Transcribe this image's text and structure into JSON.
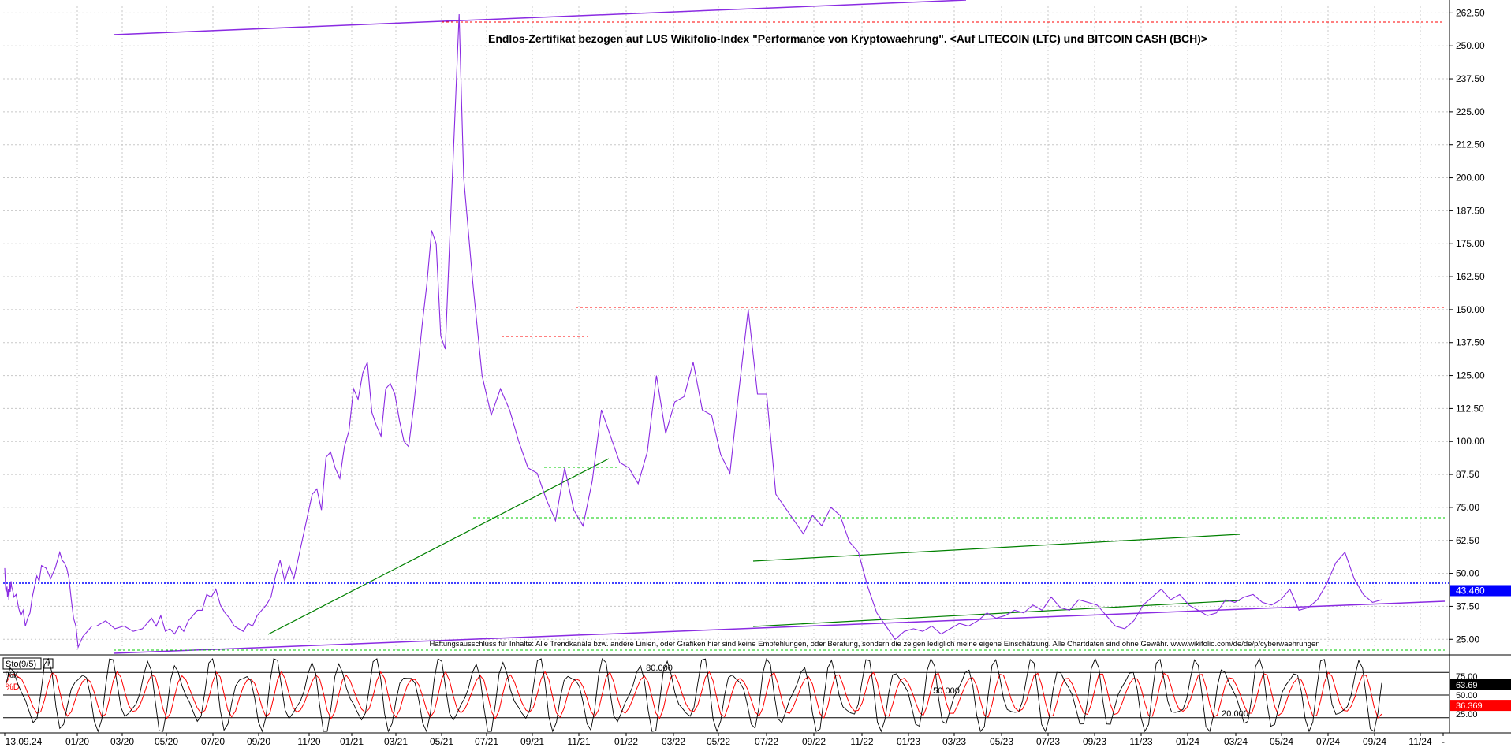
{
  "chart_data": {
    "type": "line",
    "title": "Endlos-Zertifikat bezogen auf LUS Wikifolio-Index \"Performance von Kryptowaehrung\". <Auf LITECOIN (LTC) und BITCOIN CASH (BCH)>",
    "disclaimer": "Haftungsausschluss für Inhalte: Alle Trendkanäle bzw. andere Linien, oder Grafiken hier sind keine Empfehlungen, oder Beratung, sondern die zeigen lediglich meine eigene Einschätzung. Alle Chartdaten sind ohne Gewähr.  www.wikifolio.com/de/de/p/cyberwaehrungen",
    "ylim": [
      20,
      265
    ],
    "y_ticks": [
      "262.50",
      "250.00",
      "237.50",
      "225.00",
      "212.50",
      "200.00",
      "187.50",
      "175.00",
      "162.50",
      "150.00",
      "137.50",
      "125.00",
      "112.50",
      "100.00",
      "87.50",
      "75.00",
      "62.50",
      "50.00",
      "37.50",
      "25.00"
    ],
    "x_ticks": [
      "13.09.24",
      "01/20",
      "03/20",
      "05/20",
      "07/20",
      "09/20",
      "11/20",
      "01/21",
      "03/21",
      "05/21",
      "07/21",
      "09/21",
      "11/21",
      "01/22",
      "03/22",
      "05/22",
      "07/22",
      "09/22",
      "11/22",
      "01/23",
      "03/23",
      "05/23",
      "07/23",
      "09/23",
      "11/23",
      "01/24",
      "03/24",
      "05/24",
      "07/24",
      "09/24",
      "11/24",
      "-"
    ],
    "last_value_label": "43.460",
    "price_series": {
      "name": "",
      "color": "#8a2be2",
      "x": [
        0,
        0.02,
        0.03,
        0.05,
        0.06,
        0.08,
        0.09,
        0.11,
        0.12,
        0.14,
        0.15,
        0.18,
        0.2,
        0.25,
        0.3,
        0.35,
        0.4,
        0.45,
        0.5,
        0.55,
        0.6,
        0.65,
        0.7,
        0.75,
        0.8,
        0.9,
        1.0,
        1.1,
        1.2,
        1.25,
        1.3,
        1.35,
        1.4,
        1.45,
        1.5,
        1.55,
        1.6,
        1.7,
        1.8,
        1.9,
        2.0,
        2.2,
        2.4,
        2.6,
        2.8,
        3.0,
        3.1,
        3.2,
        3.3,
        3.4,
        3.5,
        3.6,
        3.7,
        3.8,
        3.9,
        4.0,
        4.1,
        4.2,
        4.3,
        4.4,
        4.5,
        4.6,
        4.7,
        4.8,
        4.9,
        5.0,
        5.1,
        5.2,
        5.3,
        5.4,
        5.5,
        5.6,
        5.7,
        5.8,
        5.9,
        6.0,
        6.1,
        6.2,
        6.3,
        6.4,
        6.5,
        6.6,
        6.7,
        6.8,
        6.9,
        7.0,
        7.1,
        7.2,
        7.3,
        7.4,
        7.5,
        7.6,
        7.7,
        7.8,
        7.9,
        8.0,
        8.1,
        8.2,
        8.3,
        8.4,
        8.5,
        8.6,
        8.7,
        8.8,
        8.9,
        9.0,
        9.1,
        9.2,
        9.3,
        9.4,
        9.5,
        9.6,
        9.7,
        9.8,
        9.9,
        10.0,
        10.2,
        10.4,
        10.6,
        10.8,
        11.0,
        11.2,
        11.4,
        11.6,
        11.8,
        12.0,
        12.2,
        12.4,
        12.6,
        12.8,
        13.0,
        13.2,
        13.4,
        13.6,
        13.8,
        14.0,
        14.2,
        14.4,
        14.6,
        14.8,
        15.0,
        15.2,
        15.4,
        15.6,
        15.8,
        16.0,
        16.2,
        16.4,
        16.6,
        16.8,
        17.0,
        17.2,
        17.4,
        17.6,
        17.8,
        18.0,
        18.2,
        18.4,
        18.6,
        18.8,
        19.0,
        19.2,
        19.4,
        19.6,
        19.8,
        20.0,
        20.2,
        20.4,
        20.6,
        20.8,
        21.0,
        21.2,
        21.4,
        21.6,
        21.8,
        22.0,
        22.2,
        22.4,
        22.6,
        22.8,
        23.0,
        23.2,
        23.4,
        23.6,
        23.8,
        24.0,
        24.2,
        24.4,
        24.6,
        24.8,
        25.0,
        25.2,
        25.4,
        25.6,
        25.8,
        26.0,
        26.2,
        26.4,
        26.6,
        26.8,
        27.0,
        27.2,
        27.4,
        27.6,
        27.8,
        28.0,
        28.2,
        28.4,
        28.6,
        28.8,
        29.0,
        29.2,
        29.4,
        29.6,
        29.8,
        30.0
      ],
      "y": [
        52,
        44,
        43,
        45,
        41,
        44,
        40,
        46,
        43,
        47,
        45,
        43,
        41,
        42,
        37,
        34,
        36,
        30,
        33,
        35,
        41,
        45,
        49,
        47,
        53,
        52,
        48,
        52,
        58,
        55,
        54,
        52,
        48,
        40,
        33,
        30,
        22,
        26,
        28,
        30,
        30,
        32,
        29,
        30,
        28,
        29,
        31,
        33,
        30,
        34,
        28,
        29,
        27,
        30,
        28,
        32,
        34,
        36,
        36,
        42,
        41,
        44,
        38,
        35,
        33,
        30,
        29,
        28,
        31,
        30,
        34,
        36,
        38,
        41,
        49,
        55,
        47,
        53,
        48,
        56,
        64,
        72,
        80,
        82,
        74,
        94,
        96,
        90,
        86,
        98,
        104,
        120,
        116,
        126,
        130,
        111,
        106,
        102,
        120,
        122,
        118,
        108,
        100,
        98,
        112,
        128,
        145,
        160,
        180,
        175,
        140,
        135,
        178,
        220,
        262,
        200,
        160,
        125,
        110,
        120,
        112,
        100,
        90,
        88,
        78,
        70,
        90,
        74,
        68,
        85,
        112,
        102,
        92,
        90,
        84,
        96,
        125,
        103,
        115,
        117,
        130,
        112,
        110,
        95,
        88,
        120,
        150,
        118,
        118,
        80,
        75,
        70,
        65,
        72,
        68,
        75,
        72,
        62,
        58,
        45,
        35,
        30,
        25,
        28,
        29,
        28,
        30,
        27,
        29,
        31,
        30,
        32,
        35,
        33,
        34,
        36,
        35,
        38,
        36,
        41,
        37,
        36,
        40,
        39,
        38,
        34,
        30,
        29,
        32,
        38,
        41,
        44,
        40,
        42,
        38,
        36,
        34,
        35,
        40,
        39,
        41,
        42,
        39,
        38,
        40,
        44,
        36,
        37,
        40,
        46,
        54,
        58,
        48,
        42,
        39,
        40,
        38,
        44,
        43,
        42,
        45,
        43,
        42,
        44,
        46,
        41,
        42,
        46,
        51,
        55,
        60,
        63,
        67,
        78,
        84,
        72,
        64,
        60,
        64,
        61,
        57,
        63,
        54,
        50,
        46,
        42,
        44,
        48,
        52,
        45,
        41,
        43,
        40,
        41,
        43
      ]
    },
    "stochastic": {
      "name": "Sto(9/5)",
      "k_label": "%K",
      "d_label": "%D",
      "k_value": "63.69",
      "d_value": "36.369",
      "levels": [
        "80.000",
        "50.000",
        "20.000"
      ],
      "axis_labels": [
        "75.00",
        "50.00",
        "25.00"
      ],
      "ylim": [
        0,
        100
      ],
      "k_color": "#000000",
      "d_color": "#ff0000"
    },
    "colors": {
      "price": "#8a2be2",
      "trend_green": "#008000",
      "support_green": "#00cc00",
      "resistance_red": "#ff0000",
      "current_blue": "#0000ff",
      "grid": "#c8c8c8"
    }
  }
}
